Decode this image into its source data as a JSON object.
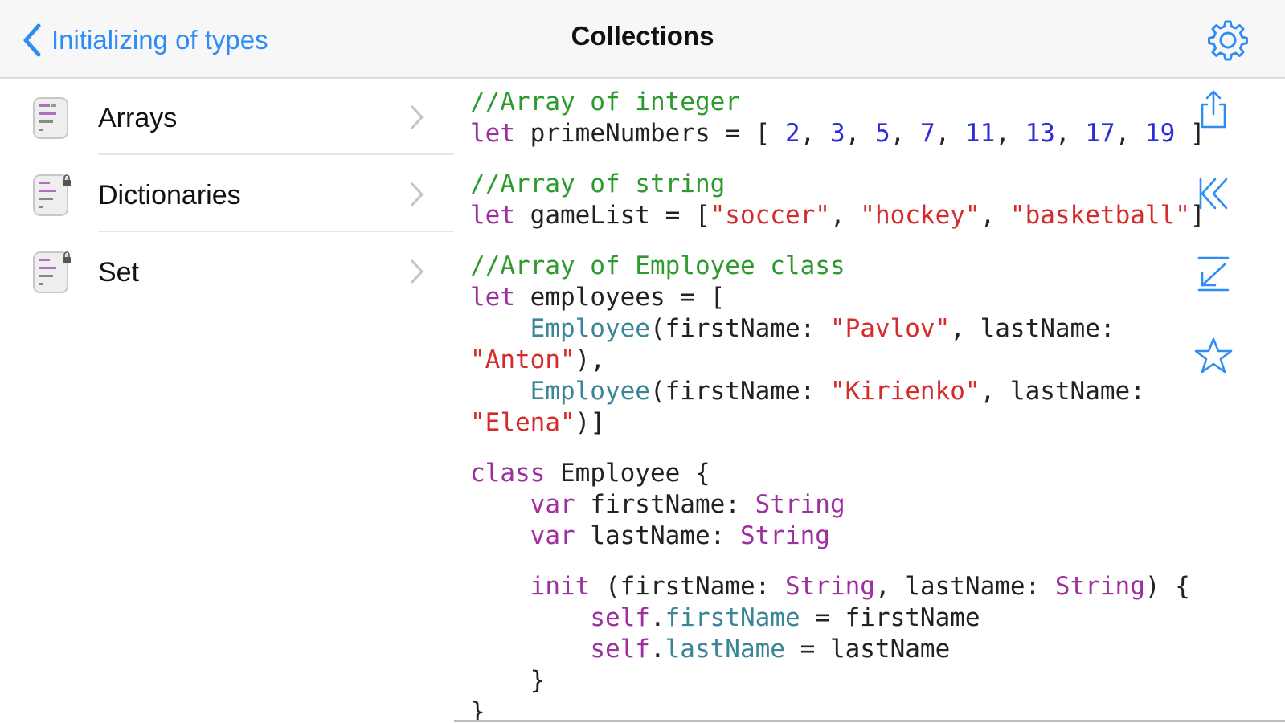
{
  "navbar": {
    "back_label": "Initializing of types",
    "title": "Collections"
  },
  "sidebar": {
    "items": [
      {
        "label": "Arrays"
      },
      {
        "label": "Dictionaries"
      },
      {
        "label": "Set"
      }
    ]
  },
  "code": {
    "lines": [
      "//Array of integer",
      "let primeNumbers = [ 2, 3, 5, 7, 11, 13, 17, 19 ]",
      "//Array of string",
      "let gameList = [\"soccer\", \"hockey\", \"basketball\"]",
      "//Array of Employee class",
      "let employees = [",
      "    Employee(firstName: \"Pavlov\", lastName:",
      "\"Anton\"),",
      "    Employee(firstName: \"Kirienko\", lastName:",
      "\"Elena\")]",
      "class Employee {",
      "    var firstName: String",
      "    var lastName: String",
      "    init (firstName: String, lastName: String) {",
      "        self.firstName = firstName",
      "        self.lastName = lastName",
      "    }",
      "}"
    ]
  },
  "colors": {
    "accent": "#2f8cf3",
    "comment": "#2e9a2e",
    "keyword": "#9d2fa0",
    "number": "#2b2bd8",
    "string": "#d42c2c",
    "type": "#3b8696"
  },
  "icons": {
    "back": "chevron-left-icon",
    "settings": "gear-icon",
    "share": "share-icon",
    "first": "skip-to-start-icon",
    "download": "download-icon",
    "favorite": "star-icon"
  }
}
